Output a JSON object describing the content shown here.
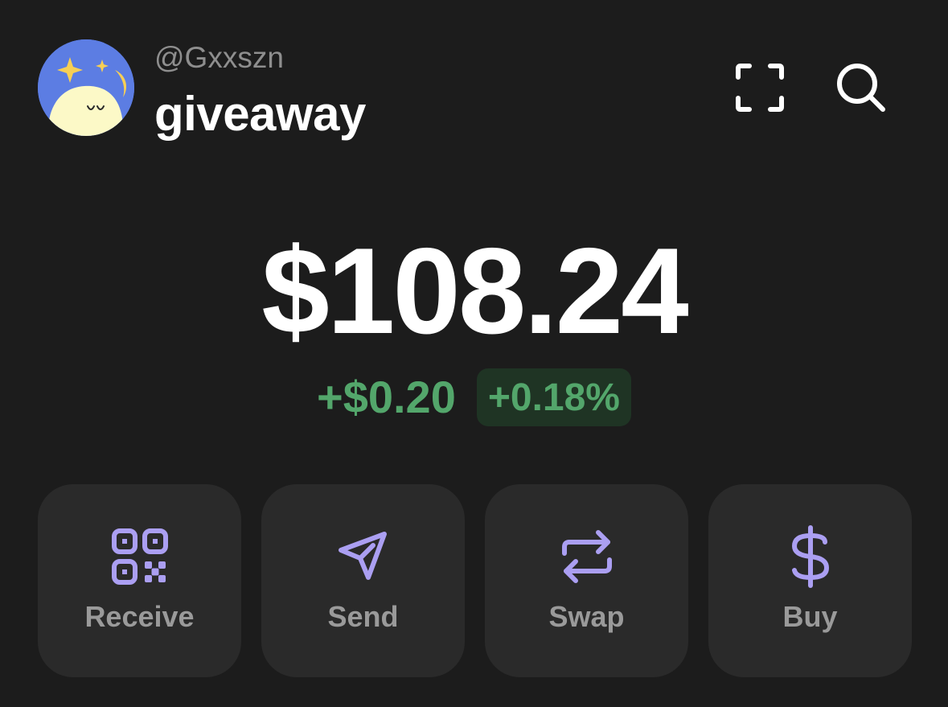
{
  "header": {
    "handle": "@Gxxszn",
    "account_name": "giveaway",
    "avatar_icon": "moon-character-avatar",
    "scan_icon": "scan-icon",
    "search_icon": "search-icon"
  },
  "balance": {
    "total": "$108.24",
    "change_amount": "+$0.20",
    "change_percent": "+0.18%"
  },
  "actions": [
    {
      "label": "Receive",
      "icon": "qr-code-icon"
    },
    {
      "label": "Send",
      "icon": "send-icon"
    },
    {
      "label": "Swap",
      "icon": "swap-icon"
    },
    {
      "label": "Buy",
      "icon": "dollar-icon"
    }
  ],
  "colors": {
    "background": "#1c1c1c",
    "card": "#2a2a2a",
    "accent": "#ab9ff2",
    "positive": "#53a66b",
    "positive_bg": "#1f3424",
    "muted_text": "#8e8e8e"
  }
}
